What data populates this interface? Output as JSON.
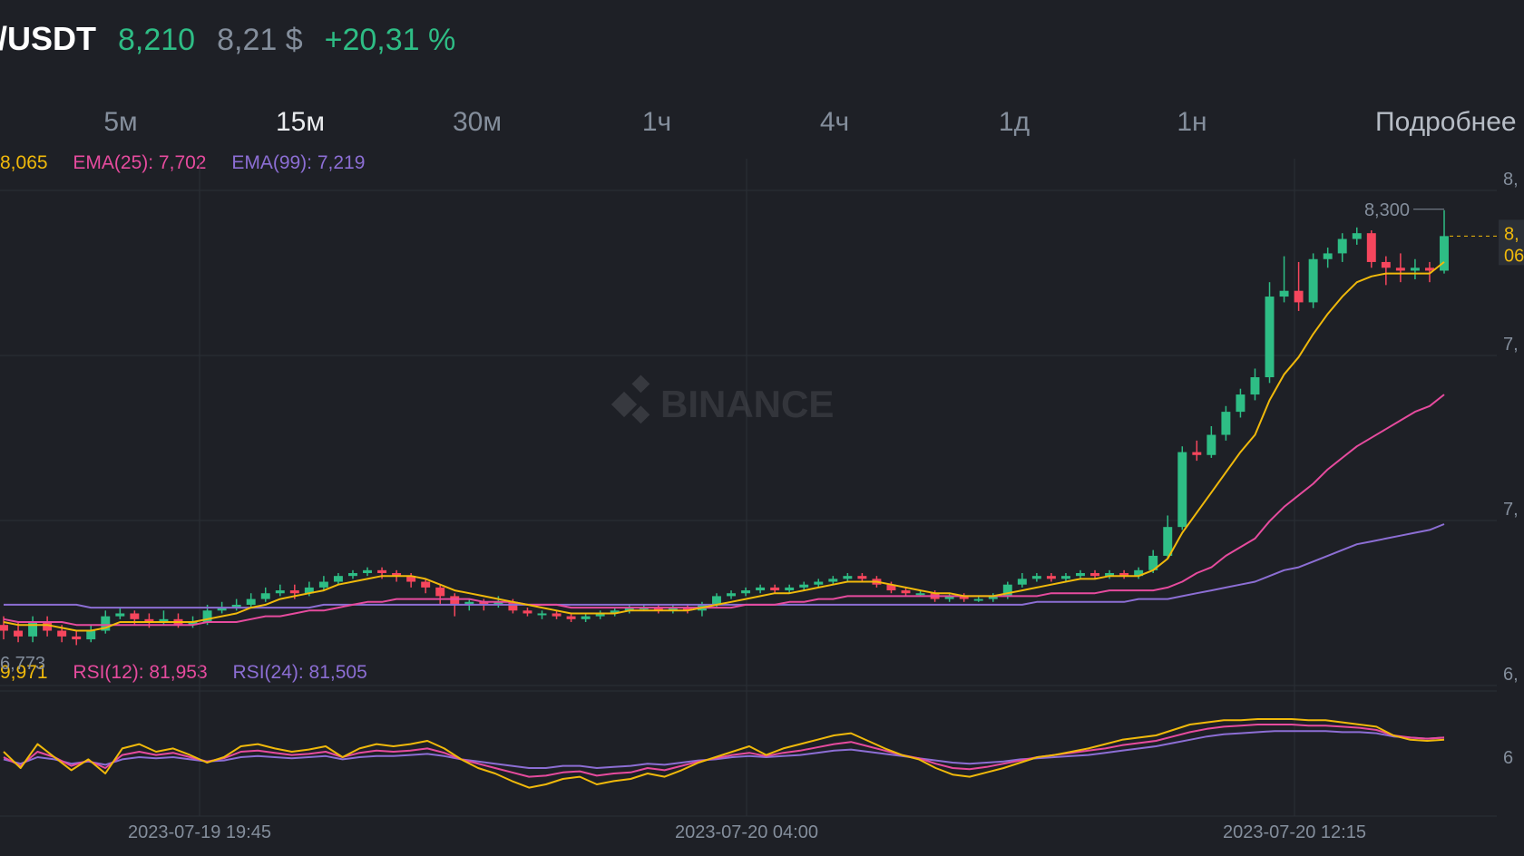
{
  "header": {
    "pair": "/USDT",
    "last_price": "8,210",
    "usd_price": "8,21 $",
    "change_24h": "+20,31 %"
  },
  "intervals": [
    {
      "label": "5м",
      "active": false
    },
    {
      "label": "15м",
      "active": true
    },
    {
      "label": "30м",
      "active": false
    },
    {
      "label": "1ч",
      "active": false
    },
    {
      "label": "4ч",
      "active": false
    },
    {
      "label": "1д",
      "active": false
    },
    {
      "label": "1н",
      "active": false
    }
  ],
  "more_label": "Подробнее",
  "indicators": {
    "ema7": "8,065",
    "ema25": "EMA(25): 7,702",
    "ema99": "EMA(99): 7,219",
    "rsi6": "9,971",
    "rsi12": "RSI(12): 81,953",
    "rsi24": "RSI(24): 81,505"
  },
  "watermark": "BINANCE",
  "colors": {
    "background": "#1e2026",
    "up": "#2ebd85",
    "down": "#f6465d",
    "ema7": "#f0b90b",
    "ema25": "#e64b9e",
    "ema99": "#8c6ed4",
    "axis_text": "#848e9c",
    "grid": "#2b2f36"
  },
  "chart_data": {
    "type": "candlestick",
    "x_ticks": [
      "2023-07-19 19:45",
      "2023-07-20 04:00",
      "2023-07-20 12:15"
    ],
    "y_tick_labels": [
      "8,",
      "7,",
      "7,",
      "6,"
    ],
    "high_label": "8,300",
    "low_label": "6,773",
    "last_price_tag": [
      "8,",
      "06"
    ],
    "ylim": [
      6.7,
      8.4
    ],
    "candles": [
      [
        6.86,
        6.84,
        6.89,
        6.81
      ],
      [
        6.84,
        6.82,
        6.87,
        6.8
      ],
      [
        6.82,
        6.87,
        6.89,
        6.8
      ],
      [
        6.87,
        6.84,
        6.89,
        6.82
      ],
      [
        6.84,
        6.82,
        6.86,
        6.8
      ],
      [
        6.82,
        6.81,
        6.84,
        6.79
      ],
      [
        6.81,
        6.84,
        6.86,
        6.8
      ],
      [
        6.84,
        6.89,
        6.91,
        6.83
      ],
      [
        6.89,
        6.9,
        6.92,
        6.88
      ],
      [
        6.9,
        6.88,
        6.91,
        6.86
      ],
      [
        6.88,
        6.87,
        6.9,
        6.85
      ],
      [
        6.87,
        6.88,
        6.91,
        6.86
      ],
      [
        6.88,
        6.86,
        6.9,
        6.85
      ],
      [
        6.86,
        6.87,
        6.89,
        6.85
      ],
      [
        6.87,
        6.91,
        6.93,
        6.86
      ],
      [
        6.91,
        6.92,
        6.94,
        6.9
      ],
      [
        6.92,
        6.93,
        6.95,
        6.91
      ],
      [
        6.93,
        6.95,
        6.97,
        6.92
      ],
      [
        6.95,
        6.97,
        6.99,
        6.94
      ],
      [
        6.97,
        6.98,
        7.0,
        6.96
      ],
      [
        6.98,
        6.97,
        7.0,
        6.95
      ],
      [
        6.97,
        6.99,
        7.01,
        6.96
      ],
      [
        6.99,
        7.01,
        7.03,
        6.98
      ],
      [
        7.01,
        7.03,
        7.04,
        7.0
      ],
      [
        7.03,
        7.04,
        7.05,
        7.02
      ],
      [
        7.04,
        7.05,
        7.06,
        7.03
      ],
      [
        7.05,
        7.04,
        7.06,
        7.02
      ],
      [
        7.04,
        7.03,
        7.05,
        7.01
      ],
      [
        7.03,
        7.01,
        7.04,
        6.99
      ],
      [
        7.01,
        6.99,
        7.02,
        6.97
      ],
      [
        6.99,
        6.96,
        7.0,
        6.93
      ],
      [
        6.96,
        6.93,
        6.97,
        6.89
      ],
      [
        6.93,
        6.94,
        6.95,
        6.91
      ],
      [
        6.94,
        6.93,
        6.95,
        6.91
      ],
      [
        6.93,
        6.94,
        6.96,
        6.92
      ],
      [
        6.94,
        6.91,
        6.95,
        6.9
      ],
      [
        6.91,
        6.9,
        6.92,
        6.89
      ],
      [
        6.9,
        6.9,
        6.91,
        6.88
      ],
      [
        6.9,
        6.89,
        6.91,
        6.88
      ],
      [
        6.89,
        6.88,
        6.9,
        6.87
      ],
      [
        6.88,
        6.89,
        6.9,
        6.87
      ],
      [
        6.89,
        6.9,
        6.91,
        6.88
      ],
      [
        6.9,
        6.91,
        6.92,
        6.89
      ],
      [
        6.91,
        6.92,
        6.93,
        6.9
      ],
      [
        6.92,
        6.92,
        6.93,
        6.91
      ],
      [
        6.92,
        6.91,
        6.93,
        6.9
      ],
      [
        6.91,
        6.92,
        6.93,
        6.9
      ],
      [
        6.92,
        6.91,
        6.93,
        6.9
      ],
      [
        6.91,
        6.93,
        6.94,
        6.89
      ],
      [
        6.93,
        6.96,
        6.97,
        6.92
      ],
      [
        6.96,
        6.97,
        6.98,
        6.95
      ],
      [
        6.97,
        6.98,
        6.99,
        6.96
      ],
      [
        6.98,
        6.99,
        7.0,
        6.97
      ],
      [
        6.99,
        6.98,
        7.0,
        6.97
      ],
      [
        6.98,
        6.99,
        7.0,
        6.97
      ],
      [
        6.99,
        7.0,
        7.01,
        6.98
      ],
      [
        7.0,
        7.01,
        7.02,
        6.99
      ],
      [
        7.01,
        7.02,
        7.03,
        7.0
      ],
      [
        7.02,
        7.03,
        7.04,
        7.01
      ],
      [
        7.03,
        7.02,
        7.04,
        7.01
      ],
      [
        7.02,
        7.0,
        7.03,
        6.99
      ],
      [
        7.0,
        6.98,
        7.01,
        6.97
      ],
      [
        6.98,
        6.97,
        6.99,
        6.96
      ],
      [
        6.97,
        6.97,
        6.98,
        6.96
      ],
      [
        6.97,
        6.95,
        6.98,
        6.94
      ],
      [
        6.95,
        6.96,
        6.97,
        6.94
      ],
      [
        6.96,
        6.95,
        6.97,
        6.94
      ],
      [
        6.95,
        6.95,
        6.96,
        6.94
      ],
      [
        6.95,
        6.96,
        6.97,
        6.94
      ],
      [
        6.96,
        7.0,
        7.01,
        6.95
      ],
      [
        7.0,
        7.02,
        7.04,
        6.99
      ],
      [
        7.02,
        7.03,
        7.04,
        7.01
      ],
      [
        7.03,
        7.02,
        7.04,
        7.01
      ],
      [
        7.02,
        7.03,
        7.04,
        7.01
      ],
      [
        7.03,
        7.04,
        7.05,
        7.02
      ],
      [
        7.04,
        7.03,
        7.05,
        7.02
      ],
      [
        7.03,
        7.04,
        7.05,
        7.02
      ],
      [
        7.04,
        7.03,
        7.05,
        7.02
      ],
      [
        7.03,
        7.05,
        7.06,
        7.02
      ],
      [
        7.05,
        7.1,
        7.12,
        7.04
      ],
      [
        7.1,
        7.2,
        7.24,
        7.09
      ],
      [
        7.2,
        7.46,
        7.48,
        7.19
      ],
      [
        7.46,
        7.45,
        7.5,
        7.43
      ],
      [
        7.45,
        7.52,
        7.55,
        7.44
      ],
      [
        7.52,
        7.6,
        7.62,
        7.5
      ],
      [
        7.6,
        7.66,
        7.68,
        7.58
      ],
      [
        7.66,
        7.72,
        7.75,
        7.64
      ],
      [
        7.72,
        8.0,
        8.05,
        7.7
      ],
      [
        8.0,
        8.02,
        8.14,
        7.98
      ],
      [
        8.02,
        7.98,
        8.12,
        7.95
      ],
      [
        7.98,
        8.13,
        8.15,
        7.96
      ],
      [
        8.13,
        8.15,
        8.17,
        8.1
      ],
      [
        8.15,
        8.2,
        8.22,
        8.12
      ],
      [
        8.2,
        8.22,
        8.24,
        8.18
      ],
      [
        8.22,
        8.12,
        8.23,
        8.1
      ],
      [
        8.12,
        8.1,
        8.14,
        8.04
      ],
      [
        8.1,
        8.09,
        8.15,
        8.05
      ],
      [
        8.09,
        8.1,
        8.13,
        8.06
      ],
      [
        8.1,
        8.09,
        8.12,
        8.05
      ],
      [
        8.09,
        8.21,
        8.3,
        8.08
      ]
    ],
    "ema7": [
      6.87,
      6.86,
      6.86,
      6.86,
      6.85,
      6.84,
      6.84,
      6.85,
      6.87,
      6.87,
      6.87,
      6.87,
      6.87,
      6.87,
      6.88,
      6.89,
      6.9,
      6.92,
      6.93,
      6.95,
      6.96,
      6.97,
      6.98,
      7.0,
      7.01,
      7.02,
      7.03,
      7.03,
      7.03,
      7.02,
      7.0,
      6.98,
      6.97,
      6.96,
      6.95,
      6.94,
      6.93,
      6.92,
      6.91,
      6.9,
      6.9,
      6.9,
      6.9,
      6.91,
      6.91,
      6.91,
      6.91,
      6.91,
      6.92,
      6.93,
      6.94,
      6.95,
      6.96,
      6.97,
      6.97,
      6.98,
      6.99,
      7.0,
      7.01,
      7.01,
      7.01,
      7.0,
      6.99,
      6.98,
      6.97,
      6.97,
      6.96,
      6.96,
      6.96,
      6.97,
      6.98,
      6.99,
      7.0,
      7.01,
      7.02,
      7.02,
      7.03,
      7.03,
      7.03,
      7.05,
      7.09,
      7.18,
      7.25,
      7.32,
      7.39,
      7.46,
      7.52,
      7.64,
      7.73,
      7.79,
      7.87,
      7.94,
      8.0,
      8.05,
      8.07,
      8.08,
      8.08,
      8.08,
      8.08,
      8.12
    ],
    "ema25": [
      6.88,
      6.87,
      6.87,
      6.87,
      6.87,
      6.86,
      6.86,
      6.86,
      6.86,
      6.86,
      6.86,
      6.86,
      6.86,
      6.86,
      6.87,
      6.87,
      6.87,
      6.88,
      6.89,
      6.89,
      6.9,
      6.91,
      6.91,
      6.92,
      6.93,
      6.94,
      6.94,
      6.95,
      6.95,
      6.95,
      6.95,
      6.95,
      6.95,
      6.94,
      6.94,
      6.94,
      6.93,
      6.93,
      6.93,
      6.92,
      6.92,
      6.92,
      6.92,
      6.92,
      6.92,
      6.92,
      6.92,
      6.92,
      6.92,
      6.92,
      6.92,
      6.93,
      6.93,
      6.93,
      6.94,
      6.94,
      6.95,
      6.95,
      6.96,
      6.96,
      6.96,
      6.96,
      6.96,
      6.96,
      6.96,
      6.96,
      6.96,
      6.96,
      6.96,
      6.96,
      6.96,
      6.96,
      6.97,
      6.97,
      6.97,
      6.97,
      6.98,
      6.98,
      6.98,
      6.98,
      6.99,
      7.01,
      7.04,
      7.06,
      7.1,
      7.13,
      7.16,
      7.22,
      7.27,
      7.31,
      7.35,
      7.4,
      7.44,
      7.48,
      7.51,
      7.54,
      7.57,
      7.6,
      7.62,
      7.66
    ],
    "ema99": [
      6.93,
      6.93,
      6.93,
      6.93,
      6.93,
      6.93,
      6.92,
      6.92,
      6.92,
      6.92,
      6.92,
      6.92,
      6.92,
      6.92,
      6.92,
      6.92,
      6.92,
      6.92,
      6.92,
      6.92,
      6.92,
      6.92,
      6.93,
      6.93,
      6.93,
      6.93,
      6.93,
      6.93,
      6.93,
      6.93,
      6.93,
      6.93,
      6.93,
      6.93,
      6.93,
      6.93,
      6.93,
      6.93,
      6.93,
      6.93,
      6.93,
      6.93,
      6.93,
      6.93,
      6.93,
      6.93,
      6.93,
      6.93,
      6.93,
      6.93,
      6.93,
      6.93,
      6.93,
      6.93,
      6.93,
      6.93,
      6.93,
      6.93,
      6.93,
      6.93,
      6.93,
      6.93,
      6.93,
      6.93,
      6.93,
      6.93,
      6.93,
      6.93,
      6.93,
      6.93,
      6.93,
      6.94,
      6.94,
      6.94,
      6.94,
      6.94,
      6.94,
      6.94,
      6.95,
      6.95,
      6.95,
      6.96,
      6.97,
      6.98,
      6.99,
      7.0,
      7.01,
      7.03,
      7.05,
      7.06,
      7.08,
      7.1,
      7.12,
      7.14,
      7.15,
      7.16,
      7.17,
      7.18,
      7.19,
      7.21
    ],
    "rsi6": [
      55,
      40,
      62,
      50,
      38,
      48,
      35,
      58,
      62,
      55,
      58,
      52,
      45,
      50,
      60,
      62,
      58,
      55,
      57,
      60,
      50,
      58,
      62,
      60,
      62,
      65,
      58,
      48,
      40,
      35,
      28,
      22,
      25,
      30,
      32,
      25,
      28,
      30,
      35,
      32,
      38,
      45,
      50,
      55,
      60,
      52,
      58,
      62,
      66,
      70,
      72,
      65,
      58,
      52,
      48,
      40,
      34,
      32,
      36,
      40,
      45,
      50,
      52,
      55,
      58,
      62,
      66,
      68,
      70,
      75,
      80,
      82,
      84,
      84,
      85,
      85,
      85,
      84,
      84,
      82,
      80,
      78,
      70,
      66,
      65,
      66
    ],
    "rsi12": [
      50,
      42,
      55,
      50,
      42,
      47,
      40,
      52,
      55,
      52,
      54,
      50,
      46,
      49,
      55,
      56,
      54,
      52,
      53,
      55,
      50,
      54,
      56,
      55,
      56,
      58,
      54,
      48,
      44,
      40,
      36,
      32,
      33,
      36,
      37,
      33,
      35,
      36,
      40,
      38,
      42,
      46,
      49,
      52,
      54,
      51,
      54,
      56,
      59,
      62,
      64,
      60,
      56,
      52,
      49,
      44,
      40,
      39,
      41,
      44,
      47,
      50,
      52,
      54,
      56,
      58,
      61,
      63,
      65,
      69,
      73,
      76,
      78,
      79,
      80,
      80,
      80,
      79,
      79,
      78,
      77,
      75,
      70,
      68,
      67,
      68
    ],
    "rsi24": [
      48,
      44,
      50,
      48,
      44,
      46,
      43,
      48,
      50,
      49,
      50,
      48,
      46,
      47,
      50,
      51,
      50,
      49,
      50,
      51,
      48,
      50,
      51,
      51,
      52,
      53,
      51,
      48,
      46,
      44,
      42,
      40,
      40,
      42,
      42,
      40,
      41,
      42,
      44,
      43,
      45,
      47,
      48,
      50,
      51,
      50,
      51,
      52,
      54,
      56,
      57,
      55,
      53,
      51,
      49,
      47,
      45,
      44,
      45,
      46,
      48,
      49,
      50,
      51,
      52,
      54,
      56,
      58,
      60,
      63,
      66,
      69,
      71,
      72,
      73,
      74,
      74,
      74,
      74,
      73,
      73,
      72,
      69,
      68,
      67,
      68
    ],
    "rsi_ylim": [
      0,
      100
    ]
  }
}
